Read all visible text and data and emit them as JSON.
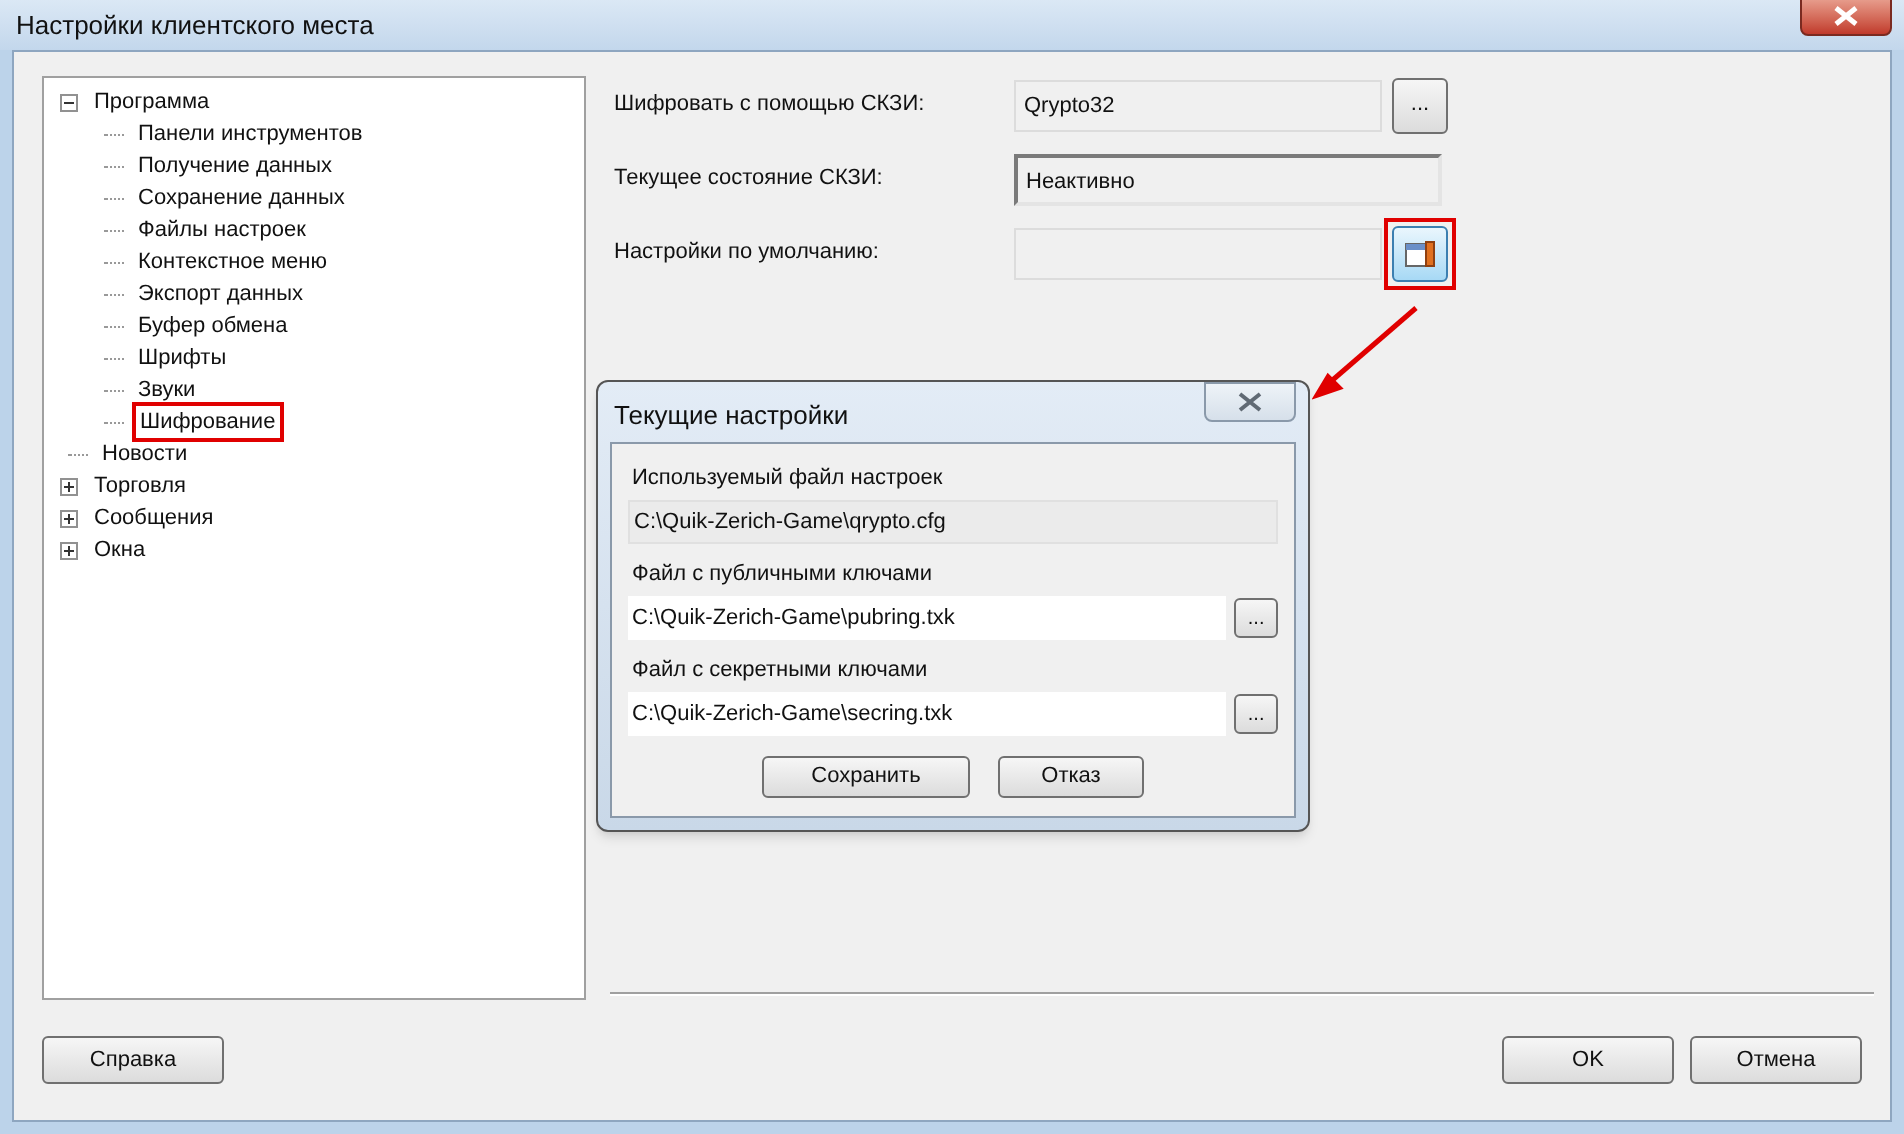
{
  "window": {
    "title": "Настройки клиентского места"
  },
  "tree": [
    {
      "label": "Программа",
      "expanded": true,
      "marked": false,
      "children": [
        {
          "label": "Панели инструментов",
          "marked": false
        },
        {
          "label": "Получение данных",
          "marked": false
        },
        {
          "label": "Сохранение данных",
          "marked": false
        },
        {
          "label": "Файлы настроек",
          "marked": false
        },
        {
          "label": "Контекстное меню",
          "marked": false
        },
        {
          "label": "Экспорт данных",
          "marked": false
        },
        {
          "label": "Буфер обмена",
          "marked": false
        },
        {
          "label": "Шрифты",
          "marked": false
        },
        {
          "label": "Звуки",
          "marked": false
        },
        {
          "label": "Шифрование",
          "marked": true
        }
      ]
    },
    {
      "label": "Новости",
      "marked": false
    },
    {
      "label": "Торговля",
      "expanded": false,
      "marked": false
    },
    {
      "label": "Сообщения",
      "expanded": false,
      "marked": false
    },
    {
      "label": "Окна",
      "expanded": false,
      "marked": false
    }
  ],
  "settings": [
    {
      "label": "Шифровать с помощью СКЗИ:",
      "value": "Qrypto32",
      "sunken": false,
      "button": {
        "kind": "browse",
        "text": "...",
        "marked": false
      }
    },
    {
      "label": "Текущее состояние СКЗИ:",
      "value": "Неактивно",
      "sunken": true
    },
    {
      "label": "Настройки по умолчанию:",
      "sunken": false,
      "button": {
        "kind": "icon",
        "marked": true
      }
    }
  ],
  "dialog": {
    "title": "Текущие настройки",
    "fields": [
      {
        "label": "Используемый файл настроек",
        "value": "C:\\Quik-Zerich-Game\\qrypto.cfg",
        "readonly": true
      },
      {
        "label": "Файл с публичными ключами",
        "value": "C:\\Quik-Zerich-Game\\pubring.txk",
        "readonly": false,
        "button": "..."
      },
      {
        "label": "Файл с секретными ключами",
        "value": "C:\\Quik-Zerich-Game\\secring.txk",
        "readonly": false,
        "button": "..."
      }
    ],
    "buttons": [
      "Сохранить",
      "Отказ"
    ]
  },
  "footer": {
    "help": "Справка",
    "buttons": [
      "OK",
      "Отмена"
    ]
  }
}
